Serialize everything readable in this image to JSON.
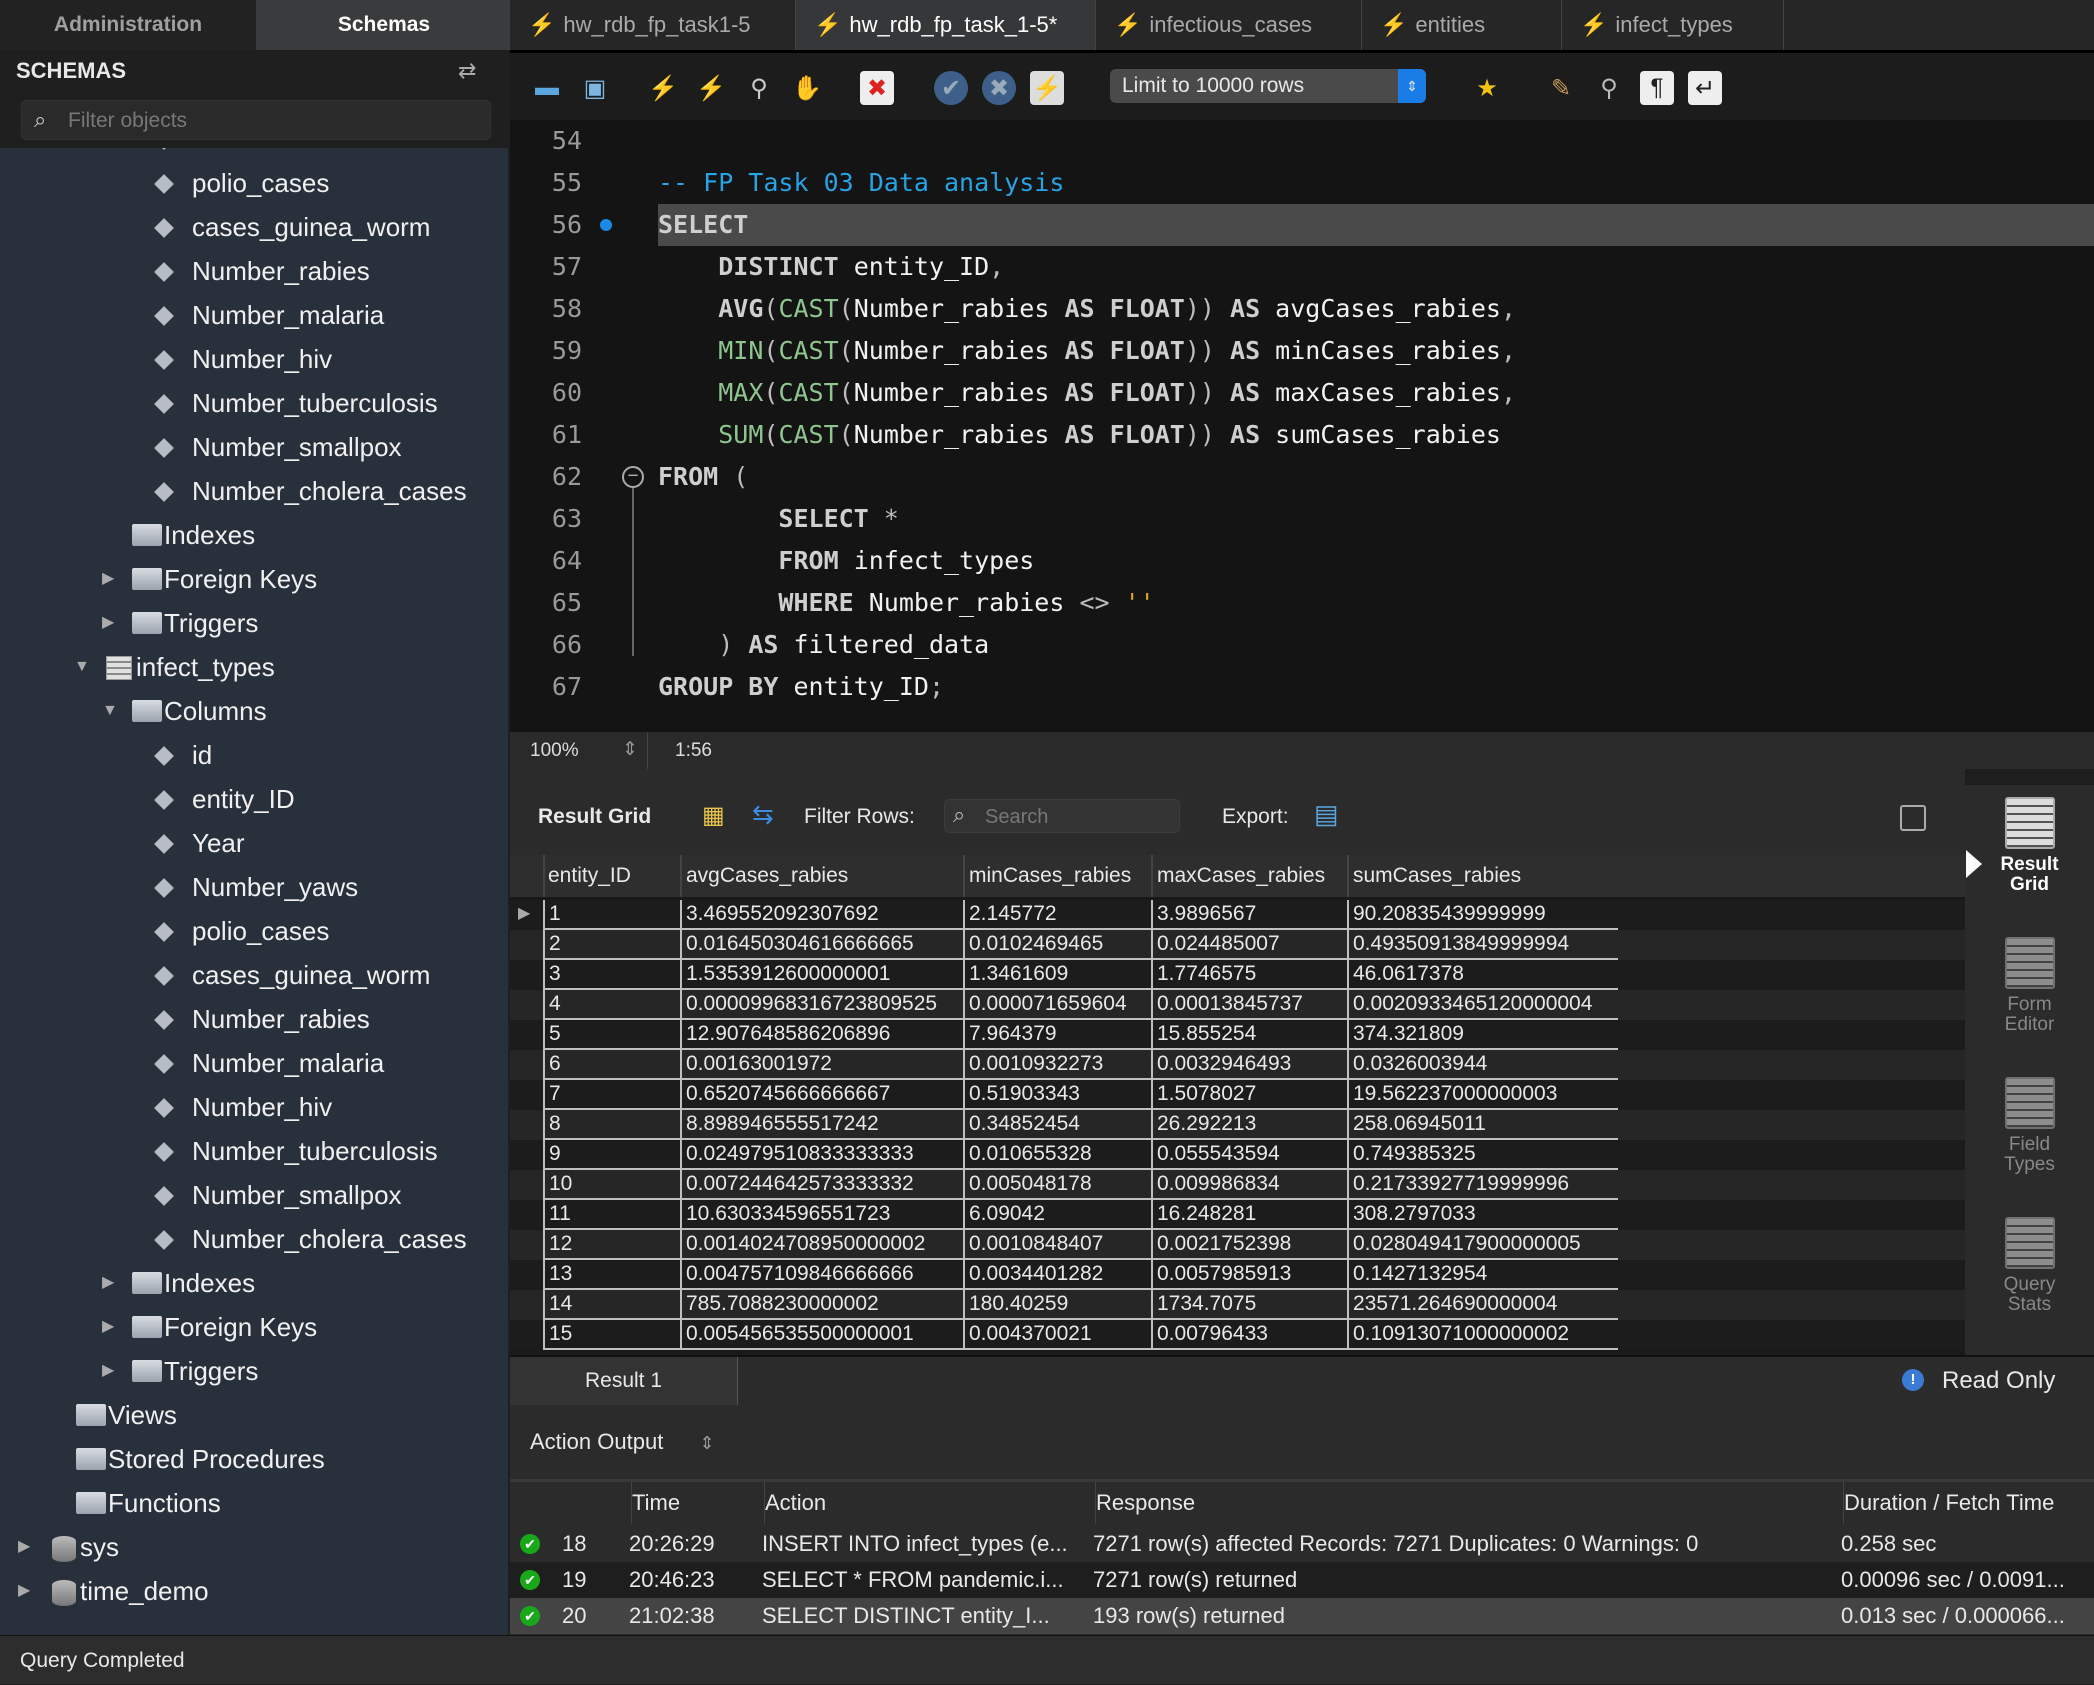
{
  "sidebar": {
    "tabs": [
      "Administration",
      "Schemas"
    ],
    "title": "SCHEMAS",
    "filter_placeholder": "Filter objects",
    "tree": [
      {
        "label": "polio_cases",
        "type": "column",
        "level": 4
      },
      {
        "label": "cases_guinea_worm",
        "type": "column",
        "level": 4
      },
      {
        "label": "Number_rabies",
        "type": "column",
        "level": 4
      },
      {
        "label": "Number_malaria",
        "type": "column",
        "level": 4
      },
      {
        "label": "Number_hiv",
        "type": "column",
        "level": 4
      },
      {
        "label": "Number_tuberculosis",
        "type": "column",
        "level": 4
      },
      {
        "label": "Number_smallpox",
        "type": "column",
        "level": 4
      },
      {
        "label": "Number_cholera_cases",
        "type": "column",
        "level": 4
      },
      {
        "label": "Indexes",
        "type": "folder",
        "level": 3,
        "expander": ""
      },
      {
        "label": "Foreign Keys",
        "type": "folder",
        "level": 3,
        "expander": "collapsed"
      },
      {
        "label": "Triggers",
        "type": "folder",
        "level": 3,
        "expander": "collapsed"
      },
      {
        "label": "infect_types",
        "type": "table",
        "level": 2,
        "expander": "expanded"
      },
      {
        "label": "Columns",
        "type": "folder",
        "level": 3,
        "expander": "expanded"
      },
      {
        "label": "id",
        "type": "column",
        "level": 4
      },
      {
        "label": "entity_ID",
        "type": "column",
        "level": 4
      },
      {
        "label": "Year",
        "type": "column",
        "level": 4
      },
      {
        "label": "Number_yaws",
        "type": "column",
        "level": 4
      },
      {
        "label": "polio_cases",
        "type": "column",
        "level": 4
      },
      {
        "label": "cases_guinea_worm",
        "type": "column",
        "level": 4
      },
      {
        "label": "Number_rabies",
        "type": "column",
        "level": 4
      },
      {
        "label": "Number_malaria",
        "type": "column",
        "level": 4
      },
      {
        "label": "Number_hiv",
        "type": "column",
        "level": 4
      },
      {
        "label": "Number_tuberculosis",
        "type": "column",
        "level": 4
      },
      {
        "label": "Number_smallpox",
        "type": "column",
        "level": 4
      },
      {
        "label": "Number_cholera_cases",
        "type": "column",
        "level": 4
      },
      {
        "label": "Indexes",
        "type": "folder",
        "level": 3,
        "expander": "collapsed"
      },
      {
        "label": "Foreign Keys",
        "type": "folder",
        "level": 3,
        "expander": "collapsed"
      },
      {
        "label": "Triggers",
        "type": "folder",
        "level": 3,
        "expander": "collapsed"
      },
      {
        "label": "Views",
        "type": "folder",
        "level": 1
      },
      {
        "label": "Stored Procedures",
        "type": "folder",
        "level": 1
      },
      {
        "label": "Functions",
        "type": "folder",
        "level": 1
      },
      {
        "label": "sys",
        "type": "db",
        "level": 0,
        "expander": "collapsed"
      },
      {
        "label": "time_demo",
        "type": "db",
        "level": 0,
        "expander": "collapsed"
      }
    ]
  },
  "tabs": [
    {
      "label": "hw_rdb_fp_task1-5",
      "active": false
    },
    {
      "label": "hw_rdb_fp_task_1-5*",
      "active": true
    },
    {
      "label": "infectious_cases",
      "active": false
    },
    {
      "label": "entities",
      "active": false
    },
    {
      "label": "infect_types",
      "active": false
    }
  ],
  "toolbar": {
    "icons": [
      "open-folder",
      "save",
      "execute",
      "execute-current",
      "explain",
      "stop",
      "toggle-error-stop",
      "commit",
      "rollback",
      "autocommit"
    ],
    "limit_select": "Limit to 10000 rows",
    "icons_right": [
      "add-snippet",
      "beautify",
      "find",
      "invisible-chars",
      "word-wrap"
    ]
  },
  "editor": {
    "lines": [
      {
        "n": "54",
        "tokens": []
      },
      {
        "n": "55",
        "tokens": [
          {
            "t": "-- FP Task 03 Data analysis",
            "k": "cm"
          }
        ]
      },
      {
        "n": "56",
        "marker": true,
        "current": true,
        "tokens": [
          {
            "t": "SELECT",
            "k": "kw"
          }
        ]
      },
      {
        "n": "57",
        "tokens": [
          {
            "t": "    "
          },
          {
            "t": "DISTINCT",
            "k": "kw"
          },
          {
            "t": " entity_ID",
            "k": "id"
          },
          {
            "t": ",",
            "k": "pn"
          }
        ]
      },
      {
        "n": "58",
        "tokens": [
          {
            "t": "    "
          },
          {
            "t": "AVG",
            "k": "kw"
          },
          {
            "t": "(",
            "k": "pn"
          },
          {
            "t": "CAST",
            "k": "fn"
          },
          {
            "t": "(",
            "k": "pn"
          },
          {
            "t": "Number_rabies ",
            "k": "id"
          },
          {
            "t": "AS FLOAT",
            "k": "kw"
          },
          {
            "t": ")) ",
            "k": "pn"
          },
          {
            "t": "AS",
            "k": "kw"
          },
          {
            "t": " avgCases_rabies",
            "k": "id"
          },
          {
            "t": ",",
            "k": "pn"
          }
        ]
      },
      {
        "n": "59",
        "tokens": [
          {
            "t": "    "
          },
          {
            "t": "MIN",
            "k": "fn"
          },
          {
            "t": "(",
            "k": "pn"
          },
          {
            "t": "CAST",
            "k": "fn"
          },
          {
            "t": "(",
            "k": "pn"
          },
          {
            "t": "Number_rabies ",
            "k": "id"
          },
          {
            "t": "AS FLOAT",
            "k": "kw"
          },
          {
            "t": ")) ",
            "k": "pn"
          },
          {
            "t": "AS",
            "k": "kw"
          },
          {
            "t": " minCases_rabies",
            "k": "id"
          },
          {
            "t": ",",
            "k": "pn"
          }
        ]
      },
      {
        "n": "60",
        "tokens": [
          {
            "t": "    "
          },
          {
            "t": "MAX",
            "k": "fn"
          },
          {
            "t": "(",
            "k": "pn"
          },
          {
            "t": "CAST",
            "k": "fn"
          },
          {
            "t": "(",
            "k": "pn"
          },
          {
            "t": "Number_rabies ",
            "k": "id"
          },
          {
            "t": "AS FLOAT",
            "k": "kw"
          },
          {
            "t": ")) ",
            "k": "pn"
          },
          {
            "t": "AS",
            "k": "kw"
          },
          {
            "t": " maxCases_rabies",
            "k": "id"
          },
          {
            "t": ",",
            "k": "pn"
          }
        ]
      },
      {
        "n": "61",
        "tokens": [
          {
            "t": "    "
          },
          {
            "t": "SUM",
            "k": "fn"
          },
          {
            "t": "(",
            "k": "pn"
          },
          {
            "t": "CAST",
            "k": "fn"
          },
          {
            "t": "(",
            "k": "pn"
          },
          {
            "t": "Number_rabies ",
            "k": "id"
          },
          {
            "t": "AS FLOAT",
            "k": "kw"
          },
          {
            "t": ")) ",
            "k": "pn"
          },
          {
            "t": "AS",
            "k": "kw"
          },
          {
            "t": " sumCases_rabies",
            "k": "id"
          }
        ]
      },
      {
        "n": "62",
        "fold": true,
        "tokens": [
          {
            "t": "FROM",
            "k": "kw"
          },
          {
            "t": " (",
            "k": "pn"
          }
        ]
      },
      {
        "n": "63",
        "tokens": [
          {
            "t": "        "
          },
          {
            "t": "SELECT",
            "k": "kw"
          },
          {
            "t": " *",
            "k": "pn"
          }
        ]
      },
      {
        "n": "64",
        "tokens": [
          {
            "t": "        "
          },
          {
            "t": "FROM",
            "k": "kw"
          },
          {
            "t": " infect_types",
            "k": "id"
          }
        ]
      },
      {
        "n": "65",
        "tokens": [
          {
            "t": "        "
          },
          {
            "t": "WHERE",
            "k": "kw"
          },
          {
            "t": " Number_rabies ",
            "k": "id"
          },
          {
            "t": "<> ",
            "k": "pn"
          },
          {
            "t": "''",
            "k": "st"
          }
        ]
      },
      {
        "n": "66",
        "tokens": [
          {
            "t": "    "
          },
          {
            "t": ") ",
            "k": "pn"
          },
          {
            "t": "AS",
            "k": "kw"
          },
          {
            "t": " filtered_data",
            "k": "id"
          }
        ]
      },
      {
        "n": "67",
        "tokens": [
          {
            "t": "GROUP BY",
            "k": "kw"
          },
          {
            "t": " entity_ID",
            "k": "id"
          },
          {
            "t": ";",
            "k": "pn"
          }
        ]
      }
    ],
    "zoom": "100%",
    "cursor": "1:56"
  },
  "results": {
    "result_grid_label": "Result Grid",
    "filter_label": "Filter Rows:",
    "search_placeholder": "Search",
    "export_label": "Export:",
    "columns": [
      "entity_ID",
      "avgCases_rabies",
      "minCases_rabies",
      "maxCases_rabies",
      "sumCases_rabies"
    ],
    "rows": [
      [
        "1",
        "3.469552092307692",
        "2.145772",
        "3.9896567",
        "90.20835439999999"
      ],
      [
        "2",
        "0.016450304616666665",
        "0.0102469465",
        "0.024485007",
        "0.49350913849999994"
      ],
      [
        "3",
        "1.5353912600000001",
        "1.3461609",
        "1.7746575",
        "46.0617378"
      ],
      [
        "4",
        "0.000099683167238095​25",
        "0.000071659604",
        "0.00013845737",
        "0.0020933465120000004"
      ],
      [
        "5",
        "12.907648586206896",
        "7.964379",
        "15.855254",
        "374.321809"
      ],
      [
        "6",
        "0.00163001972",
        "0.0010932273",
        "0.0032946493",
        "0.0326003944"
      ],
      [
        "7",
        "0.6520745666666667",
        "0.51903343",
        "1.5078027",
        "19.562237000000003"
      ],
      [
        "8",
        "8.898946555517242",
        "0.34852454",
        "26.292213",
        "258.06945011"
      ],
      [
        "9",
        "0.024979510833333333",
        "0.010655328",
        "0.055543594",
        "0.749385325"
      ],
      [
        "10",
        "0.007244642573333332",
        "0.005048178",
        "0.009986834",
        "0.21733927719999996"
      ],
      [
        "11",
        "10.630334596551723",
        "6.09042",
        "16.248281",
        "308.2797033"
      ],
      [
        "12",
        "0.0014024708950000002",
        "0.0010848407",
        "0.0021752398",
        "0.028049417900000005"
      ],
      [
        "13",
        "0.004757109846666666",
        "0.0034401282",
        "0.0057985913",
        "0.1427132954"
      ],
      [
        "14",
        "785.7088230000002",
        "180.40259",
        "1734.7075",
        "23571.264690000004"
      ],
      [
        "15",
        "0.005456535500000001",
        "0.004370021",
        "0.00796433",
        "0.10913071000000002"
      ]
    ],
    "side_buttons": [
      {
        "label": "Result Grid",
        "active": true
      },
      {
        "label": "Form Editor",
        "active": false
      },
      {
        "label": "Field Types",
        "active": false
      },
      {
        "label": "Query Stats",
        "active": false
      }
    ],
    "result_tab": "Result 1",
    "read_only": "Read Only"
  },
  "action_output": {
    "selector": "Action Output",
    "columns": [
      "",
      "Time",
      "Action",
      "Response",
      "Duration / Fetch Time"
    ],
    "rows": [
      {
        "n": "18",
        "time": "20:26:29",
        "action": "INSERT INTO infect_types (e...",
        "response": "7271 row(s) affected Records: 7271  Duplicates: 0  Warnings: 0",
        "duration": "0.258 sec"
      },
      {
        "n": "19",
        "time": "20:46:23",
        "action": "SELECT * FROM pandemic.i...",
        "response": "7271 row(s) returned",
        "duration": "0.00096 sec / 0.0091..."
      },
      {
        "n": "20",
        "time": "21:02:38",
        "action": "SELECT     DISTINCT entity_I...",
        "response": "193 row(s) returned",
        "duration": "0.013 sec / 0.000066..."
      }
    ]
  },
  "status": "Query Completed",
  "colors": {
    "accent": "#1a7de6",
    "comment": "#27a3e6",
    "function": "#8fc58f",
    "success": "#1aa81a"
  }
}
